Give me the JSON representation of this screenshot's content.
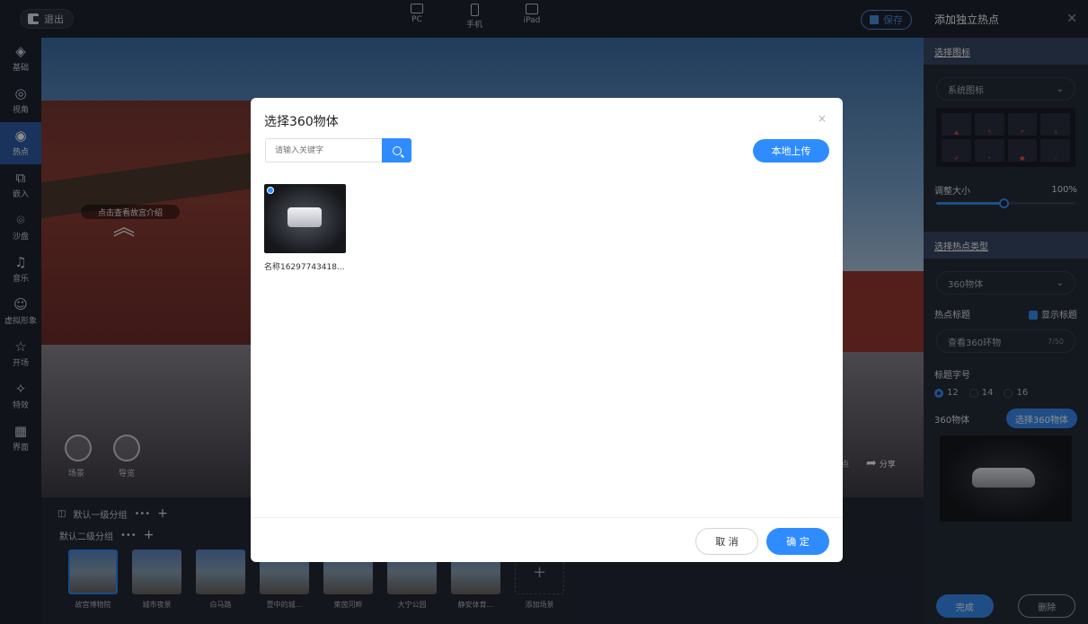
{
  "topbar": {
    "exit_label": "退出",
    "devices": [
      {
        "label": "PC",
        "icon": "desktop-icon"
      },
      {
        "label": "手机",
        "icon": "phone-icon"
      },
      {
        "label": "iPad",
        "icon": "tablet-icon"
      }
    ],
    "save_label": "保存"
  },
  "sidebar": {
    "items": [
      {
        "label": "基础",
        "icon": "layers-icon"
      },
      {
        "label": "视角",
        "icon": "eye-icon"
      },
      {
        "label": "热点",
        "icon": "target-icon",
        "active": true
      },
      {
        "label": "嵌入",
        "icon": "embed-icon"
      },
      {
        "label": "沙盘",
        "icon": "map-pin-icon"
      },
      {
        "label": "音乐",
        "icon": "music-icon"
      },
      {
        "label": "虚拟形象",
        "icon": "smile-icon"
      },
      {
        "label": "开场",
        "icon": "star-icon"
      },
      {
        "label": "特效",
        "icon": "sparkle-icon"
      },
      {
        "label": "界面",
        "icon": "grid-icon"
      }
    ]
  },
  "stage": {
    "hotspot_label": "点击查看故宫介绍",
    "scene_label": "场景",
    "view_label": "导览",
    "share_label": "分享",
    "partial_label": "点"
  },
  "strip": {
    "group1": "默认一级分组",
    "group2": "默认二级分组",
    "more": "•••",
    "add": "+",
    "scenes": [
      "故宫博物院",
      "城市夜景",
      "白马路",
      "壹中的城...",
      "莱茵河畔",
      "大宁公园",
      "静安体育..."
    ],
    "add_scene": "添加场景"
  },
  "right_panel": {
    "title": "添加独立热点",
    "close": "✕",
    "select_icon_title": "选择图标",
    "icon_source": "系统图标",
    "resize_label": "调整大小",
    "resize_value": "100%",
    "resize_level": 0.5,
    "hotspot_type_title": "选择热点类型",
    "hotspot_type": "360物体",
    "hotspot_title_label": "热点标题",
    "show_title_label": "显示标题",
    "title_input": "查看360环物",
    "title_count": "7/50",
    "font_size_label": "标题字号",
    "font_sizes": [
      "12",
      "14",
      "16"
    ],
    "object_label": "360物体",
    "choose_object_btn": "选择360物体",
    "done_btn": "完成",
    "delete_btn": "删除"
  },
  "modal": {
    "title": "选择360物体",
    "close": "×",
    "search_placeholder": "请输入关键字",
    "upload_btn": "本地上传",
    "objects": [
      {
        "name": "名称16297743418..."
      }
    ],
    "cancel_btn": "取 消",
    "ok_btn": "确 定"
  }
}
